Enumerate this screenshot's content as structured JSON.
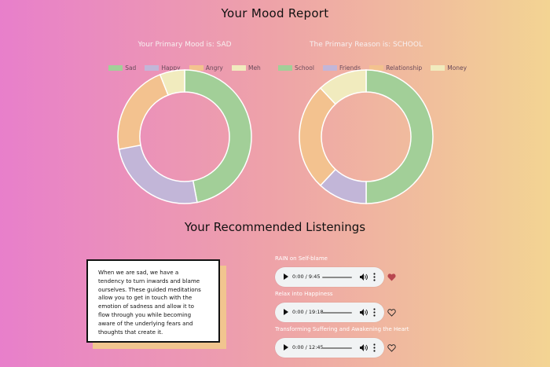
{
  "page": {
    "title": "Your Mood Report",
    "section_title": "Your Recommended Listenings"
  },
  "mood_chart": {
    "title": "Your Primary Mood is: SAD",
    "legend": [
      {
        "label": "Sad",
        "color": "#a2cf98"
      },
      {
        "label": "Happy",
        "color": "#c2b6d8"
      },
      {
        "label": "Angry",
        "color": "#f3c28f"
      },
      {
        "label": "Meh",
        "color": "#f1ebbe"
      }
    ]
  },
  "reason_chart": {
    "title": "The Primary Reason is: SCHOOL",
    "legend": [
      {
        "label": "School",
        "color": "#a2cf98"
      },
      {
        "label": "Friends",
        "color": "#c2b6d8"
      },
      {
        "label": "Relationship",
        "color": "#f3c28f"
      },
      {
        "label": "Money",
        "color": "#f1ebbe"
      }
    ]
  },
  "chart_data": [
    {
      "type": "pie",
      "title": "Your Primary Mood is: SAD",
      "categories": [
        "Sad",
        "Happy",
        "Angry",
        "Meh"
      ],
      "values": [
        47,
        25,
        22,
        6
      ],
      "colors": [
        "#a2cf98",
        "#c2b6d8",
        "#f3c28f",
        "#f1ebbe"
      ],
      "legend": "top"
    },
    {
      "type": "pie",
      "title": "The Primary Reason is: SCHOOL",
      "categories": [
        "School",
        "Friends",
        "Relationship",
        "Money"
      ],
      "values": [
        50,
        12,
        26,
        12
      ],
      "colors": [
        "#a2cf98",
        "#c2b6d8",
        "#f3c28f",
        "#f1ebbe"
      ],
      "legend": "top"
    }
  ],
  "description": {
    "lines": [
      "When we are sad, we have a",
      "tendency to turn inwards and blame",
      "ourselves. These guided meditations",
      "allow you to get in touch with the",
      "emotion of sadness and allow it to",
      "flow through you while becoming",
      "aware of the underlying fears and",
      "thoughts that create it."
    ]
  },
  "tracks": [
    {
      "title": "RAIN on Self-blame",
      "time": "0:00 / 9:45",
      "liked": true
    },
    {
      "title": "Relax into Happiness",
      "time": "0:00 / 19:18",
      "liked": false
    },
    {
      "title": "Transforming Suffering and Awakening the Heart",
      "time": "0:00 / 12:45",
      "liked": false
    }
  ]
}
